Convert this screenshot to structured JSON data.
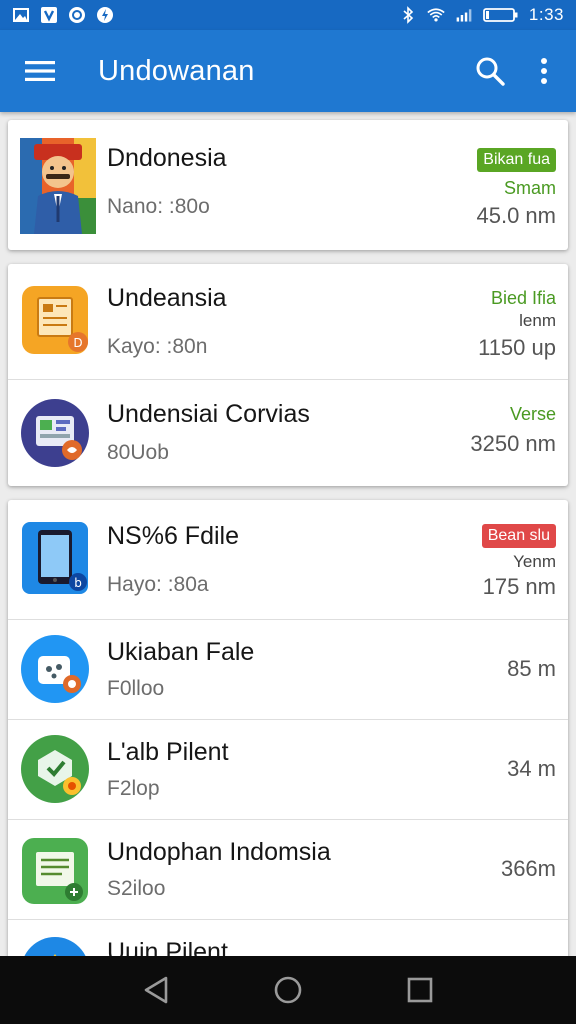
{
  "status_bar": {
    "time": "1:33"
  },
  "app_bar": {
    "title": "Undowanan"
  },
  "list": [
    {
      "title": "Dndonesia",
      "subtitle": "Nano: :80o",
      "badge": "Bikan fua",
      "badge_color": "#5aa624",
      "note": "Smam",
      "size": "45.0 nm",
      "icon": "cartoon-man-icon"
    },
    {
      "title": "Undeansia",
      "subtitle": "Kayo: :80n",
      "badge": "",
      "note_green": "Bied Ifia",
      "note": "lenm",
      "size": "1150 up",
      "icon": "document-app-icon"
    },
    {
      "title": "Undensiai Corvias",
      "subtitle": "80Uob",
      "badge": "",
      "note_green": "Verse",
      "note": "",
      "size": "3250 nm",
      "icon": "chat-app-icon"
    },
    {
      "title": "NS%6 Fdile",
      "subtitle": "Hayo: :80a",
      "badge": "Bean slu",
      "badge_color": "#e04848",
      "note": "Yenm",
      "size": "175 nm",
      "icon": "tablet-app-icon"
    },
    {
      "title": "Ukiaban Fale",
      "subtitle": "F0lloo",
      "badge": "",
      "note": "",
      "size": "85 m",
      "icon": "camera-app-icon"
    },
    {
      "title": "L'alb Pilent",
      "subtitle": "F2lop",
      "badge": "",
      "note": "",
      "size": "34 m",
      "icon": "shield-app-icon"
    },
    {
      "title": "Undophan Indomsia",
      "subtitle": "S2iloo",
      "badge": "",
      "note": "",
      "size": "366m",
      "icon": "notes-app-icon"
    },
    {
      "title": "Uuin Pilent",
      "subtitle": "",
      "badge": "",
      "note": "",
      "size": "",
      "icon": "partial-app-icon"
    }
  ],
  "colors": {
    "status_bar": "#1769c2",
    "app_bar": "#1f78d1",
    "nav_bar": "#0c0c0c"
  }
}
